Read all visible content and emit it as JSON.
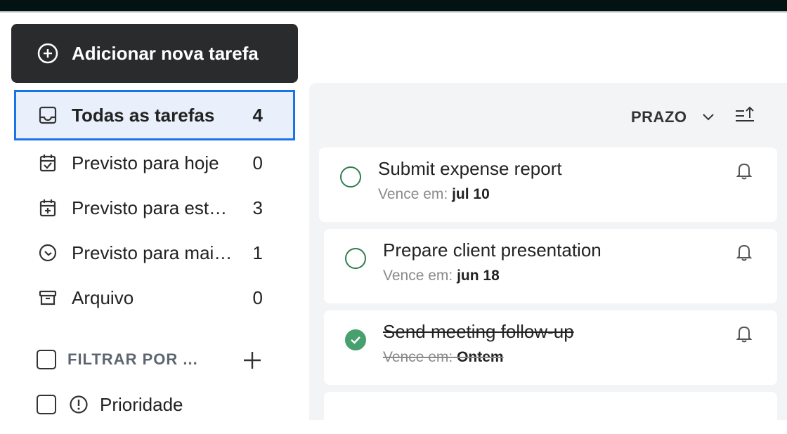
{
  "add_button": {
    "label": "Adicionar nova tarefa"
  },
  "nav": {
    "items": [
      {
        "label": "Todas as tarefas",
        "count": "4"
      },
      {
        "label": "Previsto para hoje",
        "count": "0"
      },
      {
        "label": "Previsto para esta semana",
        "count": "3"
      },
      {
        "label": "Previsto para mais tarde",
        "count": "1"
      },
      {
        "label": "Arquivo",
        "count": "0"
      }
    ]
  },
  "filter": {
    "label": "FILTRAR POR ..."
  },
  "priority": {
    "label": "Prioridade"
  },
  "sort": {
    "label": "PRAZO"
  },
  "tasks": [
    {
      "title": "Submit expense report",
      "due_prefix": "Vence em:",
      "due_value": "jul 10",
      "completed": false
    },
    {
      "title": "Prepare client presentation",
      "due_prefix": "Vence em:",
      "due_value": "jun 18",
      "completed": false
    },
    {
      "title": "Send meeting follow-up",
      "due_prefix": "Vence em:",
      "due_value": "Ontem",
      "completed": true
    }
  ],
  "colors": {
    "accent": "#1a73e8",
    "active_bg": "#e9f0fb",
    "check_green": "#47a06d",
    "circle_green": "#2e7d4f",
    "dark_button": "#2a2b2d"
  }
}
